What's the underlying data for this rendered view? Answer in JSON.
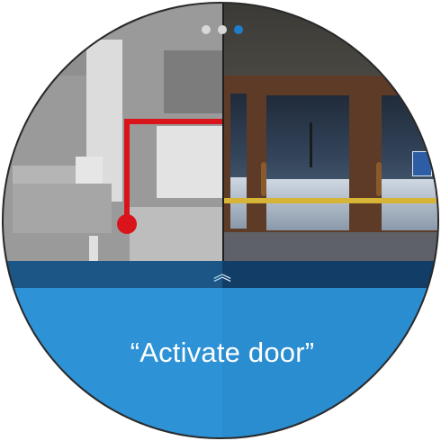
{
  "pagination": {
    "count": 3,
    "active_index": 2
  },
  "expand_control": {
    "icon": "double-chevron-up-icon",
    "glyph": "︽"
  },
  "voice_command": {
    "text": "“Activate door”"
  },
  "colors": {
    "route": "#d9141b",
    "panel": "#2b96de",
    "panel_bar": "#10406e",
    "dot_active": "#1f7ec9",
    "dot_inactive": "#d8d8d8"
  }
}
